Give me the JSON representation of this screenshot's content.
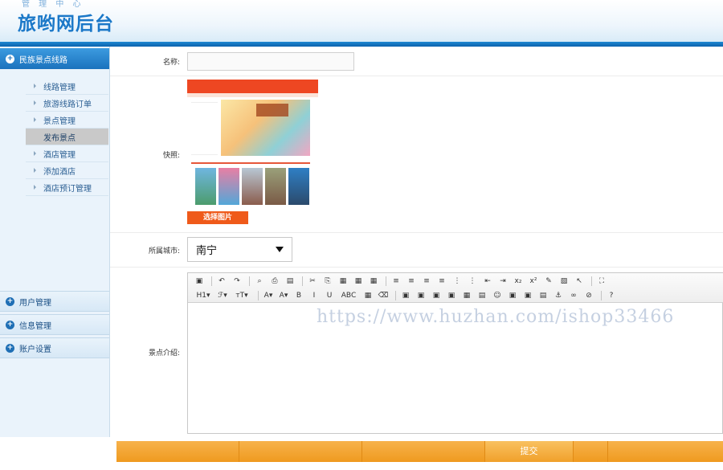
{
  "header": {
    "subtitle": "管 理 中 心",
    "title": "旅哟网后台"
  },
  "sidebar": {
    "active_section": "民族景点线路",
    "items": [
      {
        "label": "线路管理",
        "selected": false
      },
      {
        "label": "旅游线路订单",
        "selected": false
      },
      {
        "label": "景点管理",
        "selected": false
      },
      {
        "label": "发布景点",
        "selected": true
      },
      {
        "label": "酒店管理",
        "selected": false
      },
      {
        "label": "添加酒店",
        "selected": false
      },
      {
        "label": "酒店预订管理",
        "selected": false
      }
    ],
    "sections": [
      "用户管理",
      "信息管理",
      "账户设置"
    ]
  },
  "form": {
    "name_label": "名称:",
    "name_value": "",
    "snapshot_label": "快照:",
    "choose_image": "选择图片",
    "city_label": "所属城市:",
    "city_value": "南宁",
    "intro_label": "景点介绍:",
    "submit": "提交"
  },
  "editor": {
    "toolbar_row1": [
      "▣",
      "|",
      "↶",
      "↷",
      "|",
      "⌕",
      "⎙",
      "▤",
      "|",
      "✂",
      "⎘",
      "▦",
      "▦",
      "▦",
      "|",
      "≡",
      "≡",
      "≡",
      "≡",
      "⋮",
      "⋮",
      "⇤",
      "⇥",
      "x₂",
      "x²",
      "✎",
      "▧",
      "↖",
      "|",
      "⛶"
    ],
    "toolbar_row2": [
      "H1▾",
      "ℱ▾",
      "тT▾",
      "|",
      "A▾",
      "A▾",
      "B",
      "I",
      "U",
      "ABC",
      "▦",
      "⌫",
      "|",
      "▣",
      "▣",
      "▣",
      "▣",
      "▦",
      "▤",
      "☺",
      "▣",
      "▣",
      "▤",
      "⚓",
      "∞",
      "⊘",
      "|",
      "?"
    ],
    "watermark": "https://www.huzhan.com/ishop33466"
  },
  "colors": {
    "brand_blue": "#1b78c8",
    "submit_orange": "#f0a02a",
    "choose_red": "#ef5a1a"
  }
}
